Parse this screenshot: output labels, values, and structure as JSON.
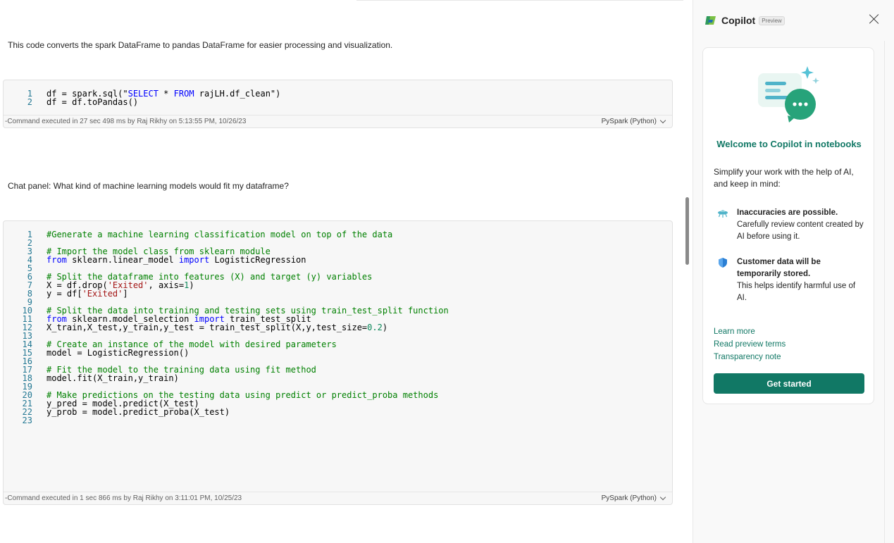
{
  "notebook": {
    "markdown_1": "This code converts the spark DataFrame to pandas DataFrame for easier processing and visualization.",
    "cell_1": {
      "lines": [
        {
          "n": "1",
          "segments": [
            [
              "",
              "df = spark.sql(\""
            ],
            [
              "kw",
              "SELECT"
            ],
            [
              "",
              " * "
            ],
            [
              "kw",
              "FROM"
            ],
            [
              "",
              " rajLH.df_clean\")"
            ]
          ]
        },
        {
          "n": "2",
          "segments": [
            [
              "",
              "df = df.toPandas()"
            ]
          ]
        }
      ],
      "status": "-Command executed in 27 sec 498 ms by Raj Rikhy on 5:13:55 PM, 10/26/23",
      "language": "PySpark (Python)"
    },
    "markdown_2": "Chat panel: What kind of machine learning models would fit my dataframe?",
    "cell_2": {
      "lines": [
        {
          "n": "1",
          "segments": [
            [
              "cm",
              "#Generate a machine learning classification model on top of the data"
            ]
          ]
        },
        {
          "n": "2",
          "segments": []
        },
        {
          "n": "3",
          "segments": [
            [
              "cm",
              "# Import the model class from sklearn module"
            ]
          ]
        },
        {
          "n": "4",
          "segments": [
            [
              "kw",
              "from"
            ],
            [
              "",
              " sklearn.linear_model "
            ],
            [
              "kw",
              "import"
            ],
            [
              "",
              " LogisticRegression"
            ]
          ]
        },
        {
          "n": "5",
          "segments": []
        },
        {
          "n": "6",
          "segments": [
            [
              "cm",
              "# Split the dataframe into features (X) and target (y) variables"
            ]
          ]
        },
        {
          "n": "7",
          "segments": [
            [
              "",
              "X = df.drop("
            ],
            [
              "st",
              "'Exited'"
            ],
            [
              "",
              ", axis="
            ],
            [
              "nm",
              "1"
            ],
            [
              "",
              ")"
            ]
          ]
        },
        {
          "n": "8",
          "segments": [
            [
              "",
              "y = df["
            ],
            [
              "st",
              "'Exited'"
            ],
            [
              "",
              "]"
            ]
          ]
        },
        {
          "n": "9",
          "segments": []
        },
        {
          "n": "10",
          "segments": [
            [
              "cm",
              "# Split the data into training and testing sets using train_test_split function"
            ]
          ]
        },
        {
          "n": "11",
          "segments": [
            [
              "kw",
              "from"
            ],
            [
              "",
              " sklearn.model_selection "
            ],
            [
              "kw",
              "import"
            ],
            [
              "",
              " train_test_split"
            ]
          ]
        },
        {
          "n": "12",
          "segments": [
            [
              "",
              "X_train,X_test,y_train,y_test = train_test_split(X,y,test_size="
            ],
            [
              "nm",
              "0.2"
            ],
            [
              "",
              ")"
            ]
          ]
        },
        {
          "n": "13",
          "segments": []
        },
        {
          "n": "14",
          "segments": [
            [
              "cm",
              "# Create an instance of the model with desired parameters"
            ]
          ]
        },
        {
          "n": "15",
          "segments": [
            [
              "",
              "model = LogisticRegression()"
            ]
          ]
        },
        {
          "n": "16",
          "segments": []
        },
        {
          "n": "17",
          "segments": [
            [
              "cm",
              "# Fit the model to the training data using fit method"
            ]
          ]
        },
        {
          "n": "18",
          "segments": [
            [
              "",
              "model.fit(X_train,y_train)"
            ]
          ]
        },
        {
          "n": "19",
          "segments": []
        },
        {
          "n": "20",
          "segments": [
            [
              "cm",
              "# Make predictions on the testing data using predict or predict_proba methods"
            ]
          ]
        },
        {
          "n": "21",
          "segments": [
            [
              "",
              "y_pred = model.predict(X_test)"
            ]
          ]
        },
        {
          "n": "22",
          "segments": [
            [
              "",
              "y_prob = model.predict_proba(X_test)"
            ]
          ]
        },
        {
          "n": "23",
          "segments": []
        }
      ],
      "status": "-Command executed in 1 sec 866 ms by Raj Rikhy on 3:11:01 PM, 10/25/23",
      "language": "PySpark (Python)"
    }
  },
  "copilot": {
    "title": "Copilot",
    "badge": "Preview",
    "welcome_title": "Welcome to Copilot in notebooks",
    "welcome_sub": "Simplify your work with the help of AI, and keep in mind:",
    "notes": [
      {
        "icon": "ufo-icon",
        "bold": "Inaccuracies are possible.",
        "text": "Carefully review content created by AI before using it."
      },
      {
        "icon": "shield-icon",
        "bold": "Customer data will be temporarily stored.",
        "text": "This helps identify harmful use of AI."
      }
    ],
    "links": [
      "Learn more",
      "Read preview terms",
      "Transparency note"
    ],
    "button": "Get started"
  },
  "colors": {
    "accent": "#117865",
    "comment": "#008000",
    "keyword": "#0000ff",
    "string": "#a31515"
  }
}
